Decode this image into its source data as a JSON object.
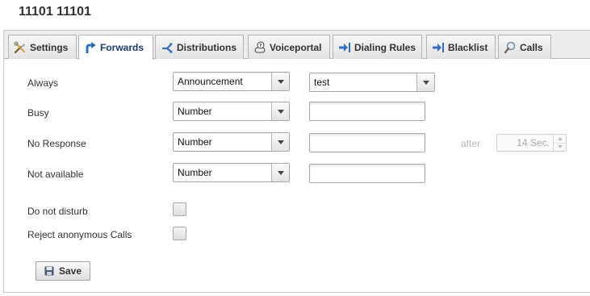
{
  "page": {
    "title": "11101 11101"
  },
  "tabs": [
    {
      "label": "Settings",
      "icon": "tools-icon",
      "active": false
    },
    {
      "label": "Forwards",
      "icon": "arrow-up-right-icon",
      "active": true
    },
    {
      "label": "Distributions",
      "icon": "distribution-icon",
      "active": false
    },
    {
      "label": "Voiceportal",
      "icon": "voiceportal-icon",
      "active": false
    },
    {
      "label": "Dialing Rules",
      "icon": "arrow-right-bar-icon",
      "active": false
    },
    {
      "label": "Blacklist",
      "icon": "arrow-right-bar-icon",
      "active": false
    },
    {
      "label": "Calls",
      "icon": "search-icon",
      "active": false
    }
  ],
  "forwards": {
    "always": {
      "label": "Always",
      "type": "Announcement",
      "target": "test"
    },
    "busy": {
      "label": "Busy",
      "type": "Number",
      "target": ""
    },
    "no_response": {
      "label": "No Response",
      "type": "Number",
      "target": "",
      "after_label": "after",
      "delay": "14 Sec."
    },
    "not_available": {
      "label": "Not available",
      "type": "Number",
      "target": ""
    }
  },
  "options": {
    "do_not_disturb": {
      "label": "Do not disturb",
      "checked": false
    },
    "reject_anonymous": {
      "label": "Reject anonymous Calls",
      "checked": false
    }
  },
  "actions": {
    "save_label": "Save"
  },
  "colors": {
    "active_tab_text": "#1a3c73",
    "tab_bar": "#ededed",
    "border": "#c9c9c9"
  }
}
